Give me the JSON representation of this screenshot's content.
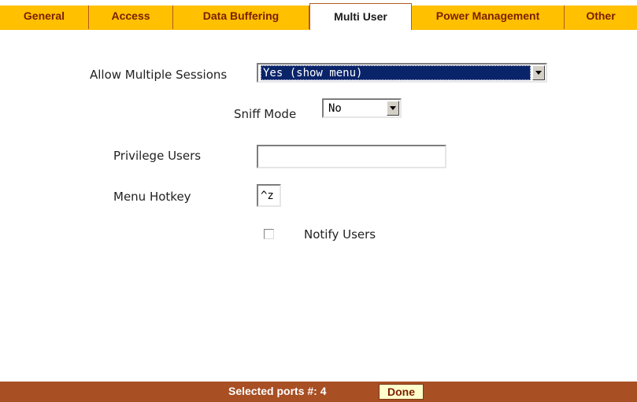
{
  "tabs": [
    {
      "label": "General",
      "active": false
    },
    {
      "label": "Access",
      "active": false
    },
    {
      "label": "Data Buffering",
      "active": false
    },
    {
      "label": "Multi User",
      "active": true
    },
    {
      "label": "Power Management",
      "active": false
    },
    {
      "label": "Other",
      "active": false
    }
  ],
  "form": {
    "allow_multiple_sessions": {
      "label": "Allow Multiple Sessions",
      "value": "Yes (show menu)"
    },
    "sniff_mode": {
      "label": "Sniff Mode",
      "value": "No"
    },
    "privilege_users": {
      "label": "Privilege Users",
      "value": ""
    },
    "menu_hotkey": {
      "label": "Menu Hotkey",
      "value": "^z"
    },
    "notify_users": {
      "label": "Notify Users",
      "checked": false
    }
  },
  "footer": {
    "selected_ports": "Selected ports #: 4",
    "done_label": "Done"
  },
  "colors": {
    "tab_background": "#ffc000",
    "tab_text": "#7a1e00",
    "footer_background": "#a84f24",
    "selection_highlight": "#0a246a"
  }
}
